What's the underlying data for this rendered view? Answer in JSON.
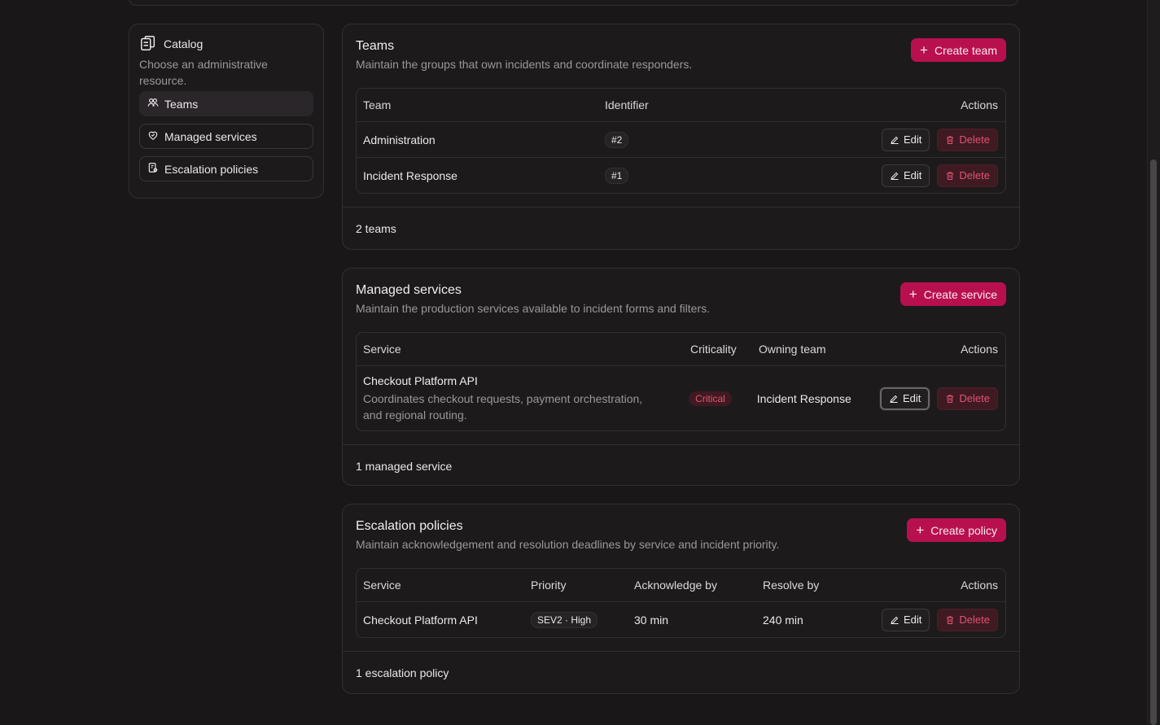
{
  "sidebar": {
    "title": "Catalog",
    "description": "Choose an administrative resource.",
    "items": [
      {
        "label": "Teams",
        "icon": "users-icon",
        "active": true
      },
      {
        "label": "Managed services",
        "icon": "heart-shield-icon",
        "active": false
      },
      {
        "label": "Escalation policies",
        "icon": "policy-doc-icon",
        "active": false
      }
    ]
  },
  "colors": {
    "accent": "#b8104f",
    "danger": "#e0536f",
    "background": "#1a1719",
    "card": "#1d1a1c"
  },
  "teams": {
    "title": "Teams",
    "subtitle": "Maintain the groups that own incidents and coordinate responders.",
    "create_label": "Create team",
    "columns": [
      "Team",
      "Identifier",
      "Actions"
    ],
    "rows": [
      {
        "name": "Administration",
        "identifier": "#2"
      },
      {
        "name": "Incident Response",
        "identifier": "#1"
      }
    ],
    "footer": "2 teams"
  },
  "services": {
    "title": "Managed services",
    "subtitle": "Maintain the production services available to incident forms and filters.",
    "create_label": "Create service",
    "columns": [
      "Service",
      "Criticality",
      "Owning team",
      "Actions"
    ],
    "rows": [
      {
        "name": "Checkout Platform API",
        "description": "Coordinates checkout requests, payment orchestration, and regional routing.",
        "criticality": "Critical",
        "owning_team": "Incident Response"
      }
    ],
    "footer": "1 managed service"
  },
  "policies": {
    "title": "Escalation policies",
    "subtitle": "Maintain acknowledgement and resolution deadlines by service and incident priority.",
    "create_label": "Create policy",
    "columns": [
      "Service",
      "Priority",
      "Acknowledge by",
      "Resolve by",
      "Actions"
    ],
    "rows": [
      {
        "service": "Checkout Platform API",
        "priority": "SEV2 · High",
        "acknowledge_by": "30 min",
        "resolve_by": "240 min"
      }
    ],
    "footer": "1 escalation policy"
  },
  "buttons": {
    "edit": "Edit",
    "delete": "Delete"
  }
}
